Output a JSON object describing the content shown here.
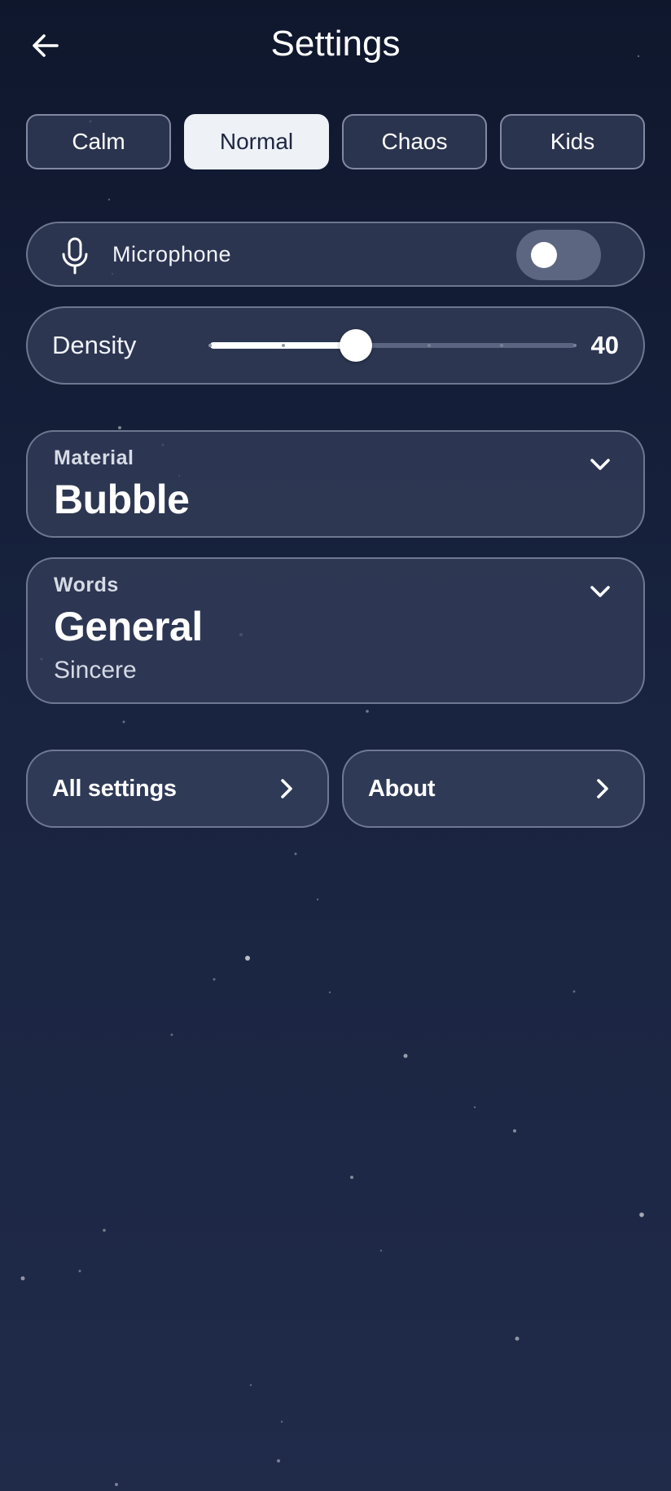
{
  "header": {
    "title": "Settings",
    "back_icon": "arrow-left-icon"
  },
  "modes": [
    {
      "label": "Calm",
      "active": false
    },
    {
      "label": "Normal",
      "active": true
    },
    {
      "label": "Chaos",
      "active": false
    },
    {
      "label": "Kids",
      "active": false
    }
  ],
  "microphone": {
    "label": "Microphone",
    "icon": "microphone-icon",
    "enabled": false
  },
  "density": {
    "label": "Density",
    "value": "40",
    "min": 0,
    "max": 100,
    "step": 10
  },
  "material": {
    "caption": "Material",
    "value": "Bubble",
    "icon": "chevron-down-icon"
  },
  "words": {
    "caption": "Words",
    "value": "General",
    "subvalue": "Sincere",
    "icon": "chevron-down-icon"
  },
  "nav": {
    "all_settings": "All settings",
    "about": "About",
    "icon": "chevron-right-icon"
  },
  "colors": {
    "background_top": "#0f172d",
    "background_bottom": "#202b4a",
    "card": "#36405c",
    "active_tab": "#eef1f6",
    "toggle_off": "#5d6681"
  }
}
